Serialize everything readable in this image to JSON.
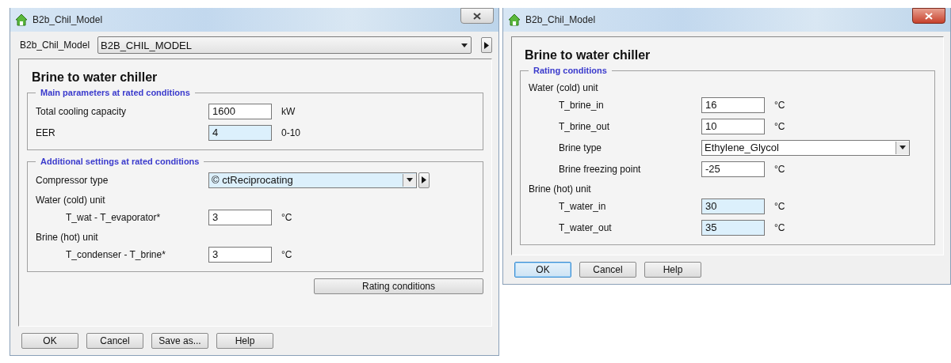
{
  "windows": [
    {
      "title": "B2b_Chil_Model",
      "active": false,
      "model_selector": {
        "label": "B2b_Chil_Model",
        "value": "B2B_CHIL_MODEL"
      },
      "heading": "Brine to water chiller",
      "groups": [
        {
          "title": "Main parameters at rated conditions",
          "rows": [
            {
              "kind": "field",
              "label": "Total cooling capacity",
              "value": "1600",
              "unit": "kW",
              "highlighted": false
            },
            {
              "kind": "field",
              "label": "EER",
              "value": "4",
              "unit": "0-10",
              "highlighted": true
            }
          ]
        },
        {
          "title": "Additional settings at rated conditions",
          "rows": [
            {
              "kind": "combo",
              "label": "Compressor type",
              "value": "© ctReciprocating",
              "highlighted": true,
              "side_button": true
            },
            {
              "kind": "unit",
              "label": "Water (cold) unit",
              "children": [
                {
                  "kind": "field",
                  "label": "T_wat - T_evaporator*",
                  "value": "3",
                  "unit": "°C",
                  "highlighted": false
                }
              ]
            },
            {
              "kind": "unit",
              "label": "Brine (hot) unit",
              "children": [
                {
                  "kind": "field",
                  "label": "T_condenser - T_brine*",
                  "value": "3",
                  "unit": "°C",
                  "highlighted": false
                }
              ]
            }
          ]
        }
      ],
      "side_action": "Rating conditions",
      "buttons": [
        {
          "label": "OK",
          "focused": false
        },
        {
          "label": "Cancel",
          "focused": false
        },
        {
          "label": "Save as...",
          "focused": false
        },
        {
          "label": "Help",
          "focused": false
        }
      ]
    },
    {
      "title": "B2b_Chil_Model",
      "active": true,
      "heading": "Brine to water chiller",
      "groups": [
        {
          "title": "Rating conditions",
          "rows": [
            {
              "kind": "unit",
              "label": "Water (cold) unit",
              "children": [
                {
                  "kind": "field",
                  "label": "T_brine_in",
                  "value": "16",
                  "unit": "°C",
                  "highlighted": false
                },
                {
                  "kind": "field",
                  "label": "T_brine_out",
                  "value": "10",
                  "unit": "°C",
                  "highlighted": false
                },
                {
                  "kind": "combo",
                  "label": "Brine type",
                  "value": "Ethylene_Glycol",
                  "highlighted": false,
                  "side_button": false
                },
                {
                  "kind": "field",
                  "label": "Brine freezing point",
                  "value": "-25",
                  "unit": "°C",
                  "highlighted": false
                }
              ]
            },
            {
              "kind": "unit",
              "label": "Brine (hot) unit",
              "children": [
                {
                  "kind": "field",
                  "label": "T_water_in",
                  "value": "30",
                  "unit": "°C",
                  "highlighted": true
                },
                {
                  "kind": "field",
                  "label": "T_water_out",
                  "value": "35",
                  "unit": "°C",
                  "highlighted": true
                }
              ]
            }
          ]
        }
      ],
      "buttons": [
        {
          "label": "OK",
          "focused": true
        },
        {
          "label": "Cancel",
          "focused": false
        },
        {
          "label": "Help",
          "focused": false
        }
      ]
    }
  ]
}
